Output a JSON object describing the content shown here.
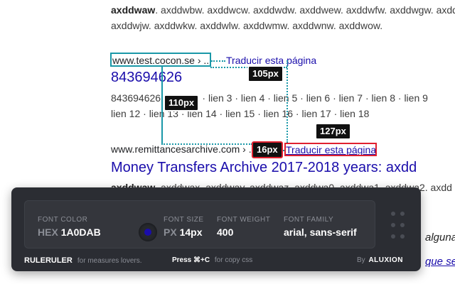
{
  "results": {
    "top_snippet_line1": {
      "bold": "axddwaw",
      "rest": ". axddwbw. axddwcw. axddwdw. axddwew. axddwfw. axddwgw. axdd"
    },
    "top_snippet_line2": "axddwjw. axddwkw. axddwlw. axddwmw. axddwnw. axddwow.",
    "r1": {
      "cite": "www.test.cocon.se › ...",
      "translate": "Traducir esta página",
      "title": "843694626",
      "snippet_line1": "843694626 ·  · lien 2 · lien 3 · lien 4 · lien 5 · lien 6 · lien 7 · lien 8 · lien 9",
      "snippet_line2": "lien 12 · lien 13 · lien 14 · lien 15 · lien 16 · lien 17 · lien 18"
    },
    "r2": {
      "cite": "www.remittancesarchive.com › ...",
      "translate": "Traducir esta página",
      "title": "Money Transfers Archive 2017-2018 years: axdd",
      "snippet": {
        "bold": "axddwaw",
        "rest": ". axddwax. axddway. axddwaz. axddwa0. axddwa1. axddwa2. axdd"
      }
    },
    "right_italic_1": "alguna",
    "right_italic_2": "que se"
  },
  "ruler": {
    "badge_105": "105px",
    "badge_110": "110px",
    "badge_127": "127px",
    "badge_16": "16px",
    "accent_color": "#1a98a8",
    "selected_color": "#e0202f"
  },
  "panel": {
    "font_color_label": "FONT COLOR",
    "hex_prefix": "HEX",
    "hex_value": "1A0DAB",
    "swatch_color": "#1a0dab",
    "font_size_label": "FONT SIZE",
    "px_prefix": "PX",
    "font_size_value": "14px",
    "font_weight_label": "FONT WEIGHT",
    "font_weight_value": "400",
    "font_family_label": "FONT FAMILY",
    "font_family_value": "arial, sans-serif",
    "brand_name": "RULERULER",
    "brand_tagline": "for measures lovers.",
    "press_label": "Press ⌘+C",
    "press_suffix": "for copy css",
    "by_label": "By",
    "company": "ALUXION"
  }
}
